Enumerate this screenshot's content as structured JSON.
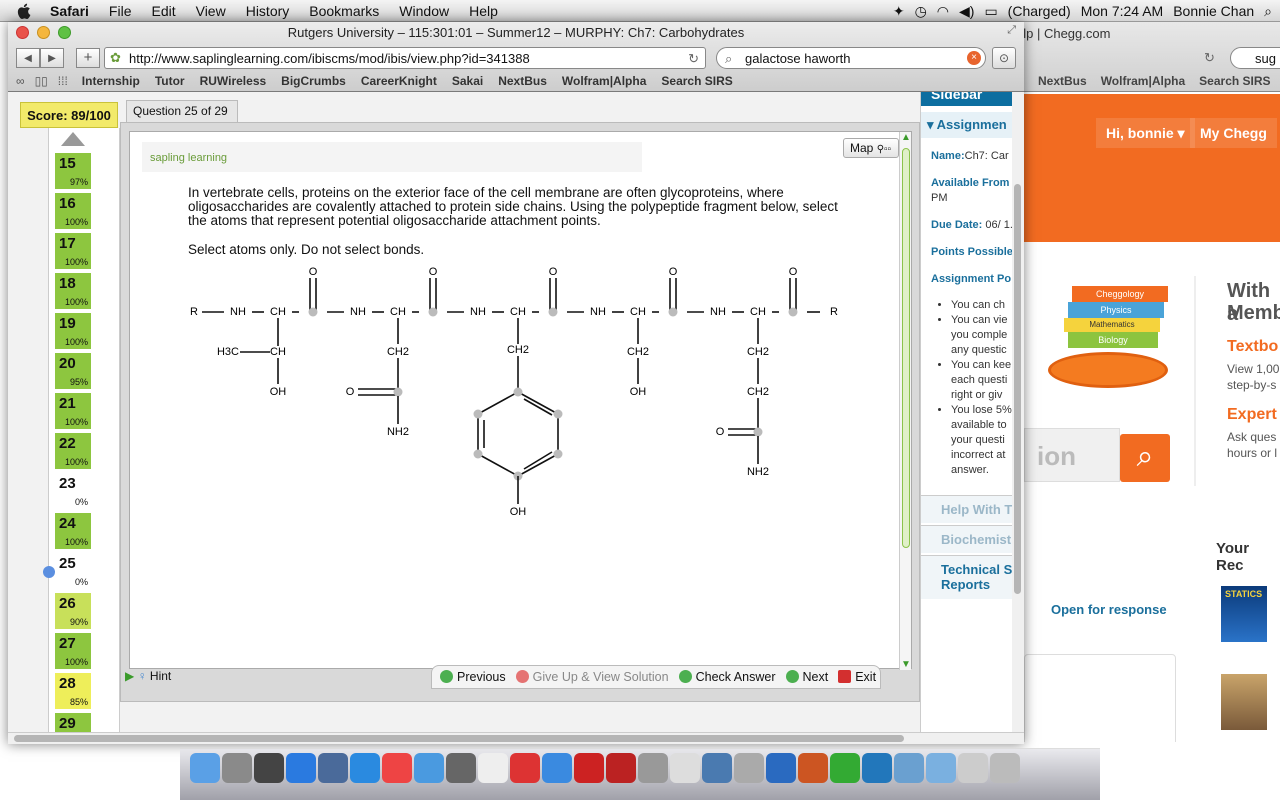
{
  "menubar": {
    "app": "Safari",
    "items": [
      "File",
      "Edit",
      "View",
      "History",
      "Bookmarks",
      "Window",
      "Help"
    ],
    "battery": "(Charged)",
    "clock": "Mon 7:24 AM",
    "user": "Bonnie Chan"
  },
  "window": {
    "title": "Rutgers University – 115:301:01 – Summer12 – MURPHY: Ch7: Carbohydrates",
    "url": "http://www.saplinglearning.com/ibiscms/mod/ibis/view.php?id=341388",
    "search": "galactose haworth",
    "bookmarks": [
      "Internship",
      "Tutor",
      "RUWireless",
      "BigCrumbs",
      "CareerKnight",
      "Sakai",
      "NextBus",
      "Wolfram|Alpha",
      "Search SIRS"
    ]
  },
  "bg_window": {
    "title": "elp | Chegg.com",
    "search_fragment": "sug",
    "bookmarks": [
      "NextBus",
      "Wolfram|Alpha",
      "Search SIRS"
    ],
    "greeting": "Hi, bonnie",
    "mychegg": "My Chegg",
    "with_a": "With a",
    "memb": "Memb",
    "textbo": "Textbo",
    "view_line": "View 1,00",
    "step_line": "step-by-s",
    "expert": "Expert",
    "ask_line": "Ask ques",
    "hours_line": "hours or l",
    "search_text": "ion",
    "your_rec": "Your Rec",
    "open_response": "Open for response",
    "book_subjects": [
      "Cheggology",
      "Physics",
      "Mathematics",
      "Biology"
    ],
    "statics": "STATICS"
  },
  "quiz": {
    "score": "Score: 89/100",
    "question_tab": "Question 25 of 29",
    "map_label": "Map",
    "logo_text": "sapling learning",
    "question_text": "In vertebrate cells, proteins on the exterior face of the cell membrane are often glycoproteins, where oligosaccharides are covalently attached to protein side chains. Using the polypeptide fragment below, select the atoms that represent potential oligosaccharide attachment points.",
    "instruction": "Select atoms only. Do not select bonds.",
    "hint": "Hint",
    "actions": {
      "previous": "Previous",
      "give_up": "Give Up & View Solution",
      "check": "Check Answer",
      "next": "Next",
      "exit": "Exit"
    },
    "questions": [
      {
        "num": "15",
        "pct": "97%",
        "color": "#8dc63f"
      },
      {
        "num": "16",
        "pct": "100%",
        "color": "#8dc63f"
      },
      {
        "num": "17",
        "pct": "100%",
        "color": "#8dc63f"
      },
      {
        "num": "18",
        "pct": "100%",
        "color": "#8dc63f"
      },
      {
        "num": "19",
        "pct": "100%",
        "color": "#8dc63f"
      },
      {
        "num": "20",
        "pct": "95%",
        "color": "#8dc63f"
      },
      {
        "num": "21",
        "pct": "100%",
        "color": "#8dc63f"
      },
      {
        "num": "22",
        "pct": "100%",
        "color": "#8dc63f"
      },
      {
        "num": "23",
        "pct": "0%",
        "color": "#ffffff"
      },
      {
        "num": "24",
        "pct": "100%",
        "color": "#8dc63f"
      },
      {
        "num": "25",
        "pct": "0%",
        "color": "#ffffff"
      },
      {
        "num": "26",
        "pct": "90%",
        "color": "#c8e05a"
      },
      {
        "num": "27",
        "pct": "100%",
        "color": "#8dc63f"
      },
      {
        "num": "28",
        "pct": "85%",
        "color": "#eeee5a"
      },
      {
        "num": "29",
        "pct": "",
        "color": "#8dc63f"
      }
    ]
  },
  "molecule": {
    "labels": [
      "R",
      "NH",
      "CH",
      "NH",
      "CH",
      "NH",
      "CH",
      "NH",
      "CH",
      "NH",
      "CH",
      "R",
      "O",
      "O",
      "O",
      "O",
      "O",
      "H3C",
      "CH",
      "OH",
      "CH2",
      "O",
      "NH2",
      "CH2",
      "OH",
      "CH2",
      "OH",
      "CH2",
      "CH2",
      "O",
      "NH2"
    ]
  },
  "sidebar": {
    "header": "Sidebar",
    "assignment": "Assignmen",
    "name_label": "Name:",
    "name_value": "Ch7: Car",
    "available_label": "Available From",
    "available_value": "PM",
    "due_label": "Due Date:",
    "due_value": "06/ 1.",
    "points_label": "Points Possible",
    "policies_label": "Assignment Po",
    "bullets": [
      "You can ch",
      "You can vie you comple any questic",
      "You can kee each questi right or giv",
      "You lose 5% available to your questi incorrect at answer."
    ],
    "links": [
      "Help With T",
      "Biochemist",
      "Technical S Reports"
    ]
  }
}
